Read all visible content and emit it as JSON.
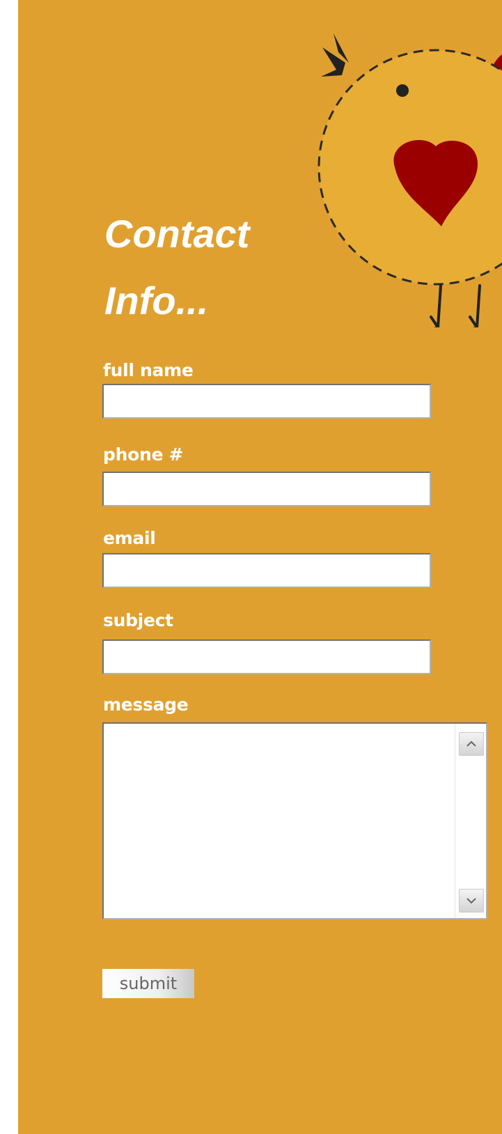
{
  "title": {
    "line1": "Contact",
    "line2": "Info..."
  },
  "form": {
    "fields": [
      {
        "label": "full name",
        "value": "",
        "placeholder": ""
      },
      {
        "label": "phone #",
        "value": "",
        "placeholder": ""
      },
      {
        "label": "email",
        "value": "",
        "placeholder": ""
      },
      {
        "label": "subject",
        "value": "",
        "placeholder": ""
      }
    ],
    "message": {
      "label": "message",
      "value": ""
    },
    "submit_label": "submit"
  },
  "icons": {
    "mascot": "chick-icon",
    "scroll_up": "chevron-up-icon",
    "scroll_down": "chevron-down-icon"
  },
  "colors": {
    "background": "#e0a030",
    "chick_body": "#e8ad35",
    "heart": "#9a0000",
    "text": "#ffffff"
  }
}
